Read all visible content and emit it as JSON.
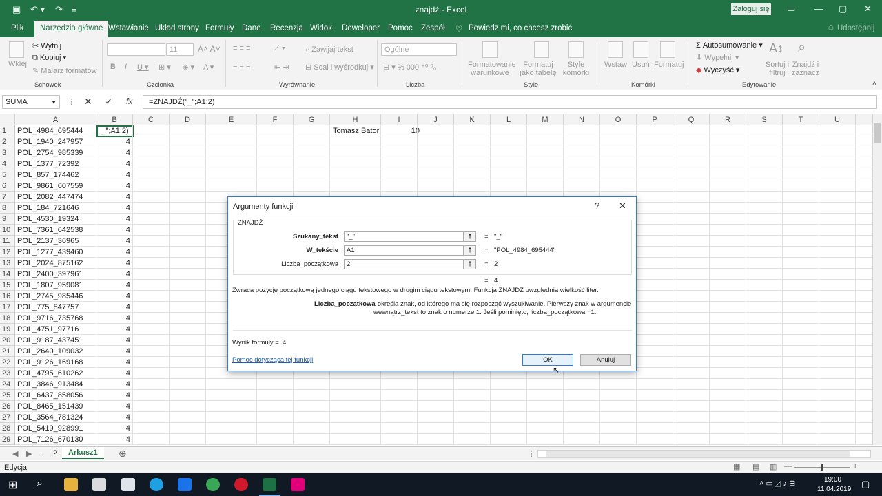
{
  "window": {
    "title": "znajdź  -  Excel",
    "signin": "Zaloguj się"
  },
  "tabs": [
    "Plik",
    "Narzędzia główne",
    "Wstawianie",
    "Układ strony",
    "Formuły",
    "Dane",
    "Recenzja",
    "Widok",
    "Deweloper",
    "Pomoc",
    "Zespół"
  ],
  "tell_me": "Powiedz mi, co chcesz zrobić",
  "share": "Udostępnij",
  "ribbon": {
    "clipboard": {
      "paste": "Wklej",
      "cut": "Wytnij",
      "copy": "Kopiuj",
      "painter": "Malarz formatów",
      "group": "Schowek"
    },
    "font": {
      "size": "11",
      "group": "Czcionka"
    },
    "alignment": {
      "wrap": "Zawijaj tekst",
      "merge": "Scal i wyśrodkuj",
      "group": "Wyrównanie"
    },
    "number": {
      "format": "Ogólne",
      "group": "Liczba"
    },
    "styles": {
      "cond": "Formatowanie warunkowe",
      "table": "Formatuj jako tabelę",
      "cell": "Style komórki",
      "group": "Style"
    },
    "cells": {
      "insert": "Wstaw",
      "delete": "Usuń",
      "format": "Formatuj",
      "group": "Komórki"
    },
    "editing": {
      "autosum": "Autosumowanie",
      "fill": "Wypełnij",
      "clear": "Wyczyść",
      "sort": "Sortuj i filtruj",
      "find": "Znajdź i zaznacz",
      "group": "Edytowanie"
    }
  },
  "formula_bar": {
    "name_box": "SUMA",
    "fx": "fx",
    "formula": "=ZNAJDŹ(\"_\";A1;2)"
  },
  "columns": [
    "A",
    "B",
    "C",
    "D",
    "E",
    "F",
    "G",
    "H",
    "I",
    "J",
    "K",
    "L",
    "M",
    "N",
    "O",
    "P",
    "Q",
    "R",
    "S",
    "T",
    "U"
  ],
  "rows": [
    {
      "n": "1",
      "a": "POL_4984_695444",
      "b": "_\";A1;2)"
    },
    {
      "n": "2",
      "a": "POL_1940_247957",
      "b": "4"
    },
    {
      "n": "3",
      "a": "POL_2754_985339",
      "b": "4"
    },
    {
      "n": "4",
      "a": "POL_1377_72392",
      "b": "4"
    },
    {
      "n": "5",
      "a": "POL_857_174462",
      "b": "4"
    },
    {
      "n": "6",
      "a": "POL_9861_607559",
      "b": "4"
    },
    {
      "n": "7",
      "a": "POL_2082_447474",
      "b": "4"
    },
    {
      "n": "8",
      "a": "POL_184_721646",
      "b": "4"
    },
    {
      "n": "9",
      "a": "POL_4530_19324",
      "b": "4"
    },
    {
      "n": "10",
      "a": "POL_7361_642538",
      "b": "4"
    },
    {
      "n": "11",
      "a": "POL_2137_36965",
      "b": "4"
    },
    {
      "n": "12",
      "a": "POL_1277_439460",
      "b": "4"
    },
    {
      "n": "13",
      "a": "POL_2024_875162",
      "b": "4"
    },
    {
      "n": "14",
      "a": "POL_2400_397961",
      "b": "4"
    },
    {
      "n": "15",
      "a": "POL_1807_959081",
      "b": "4"
    },
    {
      "n": "16",
      "a": "POL_2745_985446",
      "b": "4"
    },
    {
      "n": "17",
      "a": "POL_775_847757",
      "b": "4"
    },
    {
      "n": "18",
      "a": "POL_9716_735768",
      "b": "4"
    },
    {
      "n": "19",
      "a": "POL_4751_97716",
      "b": "4"
    },
    {
      "n": "20",
      "a": "POL_9187_437451",
      "b": "4"
    },
    {
      "n": "21",
      "a": "POL_2640_109032",
      "b": "4"
    },
    {
      "n": "22",
      "a": "POL_9126_169168",
      "b": "4"
    },
    {
      "n": "23",
      "a": "POL_4795_610262",
      "b": "4"
    },
    {
      "n": "24",
      "a": "POL_3846_913484",
      "b": "4"
    },
    {
      "n": "25",
      "a": "POL_6437_858056",
      "b": "4"
    },
    {
      "n": "26",
      "a": "POL_8465_151439",
      "b": "4"
    },
    {
      "n": "27",
      "a": "POL_3564_781324",
      "b": "4"
    },
    {
      "n": "28",
      "a": "POL_5419_928991",
      "b": "4"
    },
    {
      "n": "29",
      "a": "POL_7126_670130",
      "b": "4"
    }
  ],
  "cell_h1": "Tomasz Bator",
  "cell_i1": "10",
  "sheets": {
    "dots": "...",
    "prev": "2",
    "active": "Arkusz1"
  },
  "status": "Edycja",
  "clock": {
    "time": "19:00",
    "date": "11.04.2019"
  },
  "dialog": {
    "title": "Argumenty funkcji",
    "help": "?",
    "function": "ZNAJDŹ",
    "args": [
      {
        "label": "Szukany_tekst",
        "value": "\"_\"",
        "result": "\"_\""
      },
      {
        "label": "W_tekście",
        "value": "A1",
        "result": "\"POL_4984_695444\""
      },
      {
        "label": "Liczba_początkowa",
        "value": "2",
        "result": "2"
      }
    ],
    "eq": "=",
    "total": "4",
    "description": "Zwraca pozycję początkową jednego ciągu tekstowego w drugim ciągu tekstowym. Funkcja ZNAJDŹ uwzględnia wielkość liter.",
    "arg_name": "Liczba_początkowa",
    "arg_desc_1": "- określa znak, od którego ma się rozpocząć wyszukiwanie. Pierwszy znak w argumencie",
    "arg_desc_2": "wewnątrz_tekst to znak o numerze 1. Jeśli pominięto, liczba_początkowa =1.",
    "result_label": "Wynik formuły =",
    "result_value": "4",
    "help_link": "Pomoc dotycząca tej funkcji",
    "ok": "OK",
    "cancel": "Anuluj"
  }
}
